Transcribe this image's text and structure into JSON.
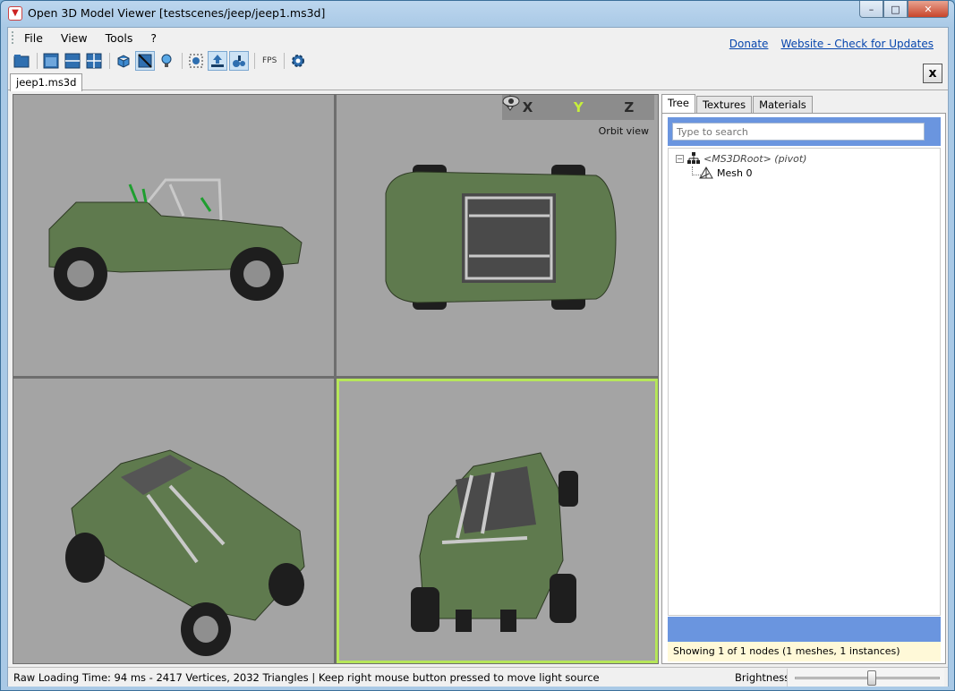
{
  "window": {
    "title": "Open 3D Model Viewer  [testscenes/jeep/jeep1.ms3d]",
    "controls": {
      "minimize": "–",
      "maximize": "□",
      "close": "✕"
    }
  },
  "menu": {
    "items": [
      "File",
      "View",
      "Tools",
      "?"
    ]
  },
  "links": {
    "donate": "Donate",
    "website": "Website - Check for Updates"
  },
  "toolbar": {
    "fps_label": "FPS",
    "icons": [
      "open-folder-icon",
      "single-view-icon",
      "two-view-icon",
      "four-view-icon",
      "wireframe-icon",
      "shaded-icon",
      "light-icon",
      "zoom-fit-icon",
      "orbit-mode-icon",
      "fps-mode-icon",
      "settings-icon"
    ]
  },
  "document": {
    "tab_label": "jeep1.ms3d",
    "close_label": "x"
  },
  "viewport": {
    "axes": [
      "X",
      "Y",
      "Z"
    ],
    "mode_label": "Orbit view",
    "active_axis": "Y",
    "active_border_color": "#b6e65a"
  },
  "side_panel": {
    "tabs": [
      "Tree",
      "Textures",
      "Materials"
    ],
    "active_tab": "Tree",
    "search_placeholder": "Type to search",
    "tree": {
      "root_label": "<MS3DRoot> (pivot)",
      "child_label": "Mesh 0",
      "expander": "−"
    },
    "info_text": "Showing 1 of 1 nodes (1 meshes, 1 instances)"
  },
  "status": {
    "text": "Raw Loading Time: 94 ms - 2417 Vertices, 2032 Triangles  | Keep right mouse button pressed to move light source",
    "brightness_label": "Brightness",
    "brightness_value": 0.53
  }
}
